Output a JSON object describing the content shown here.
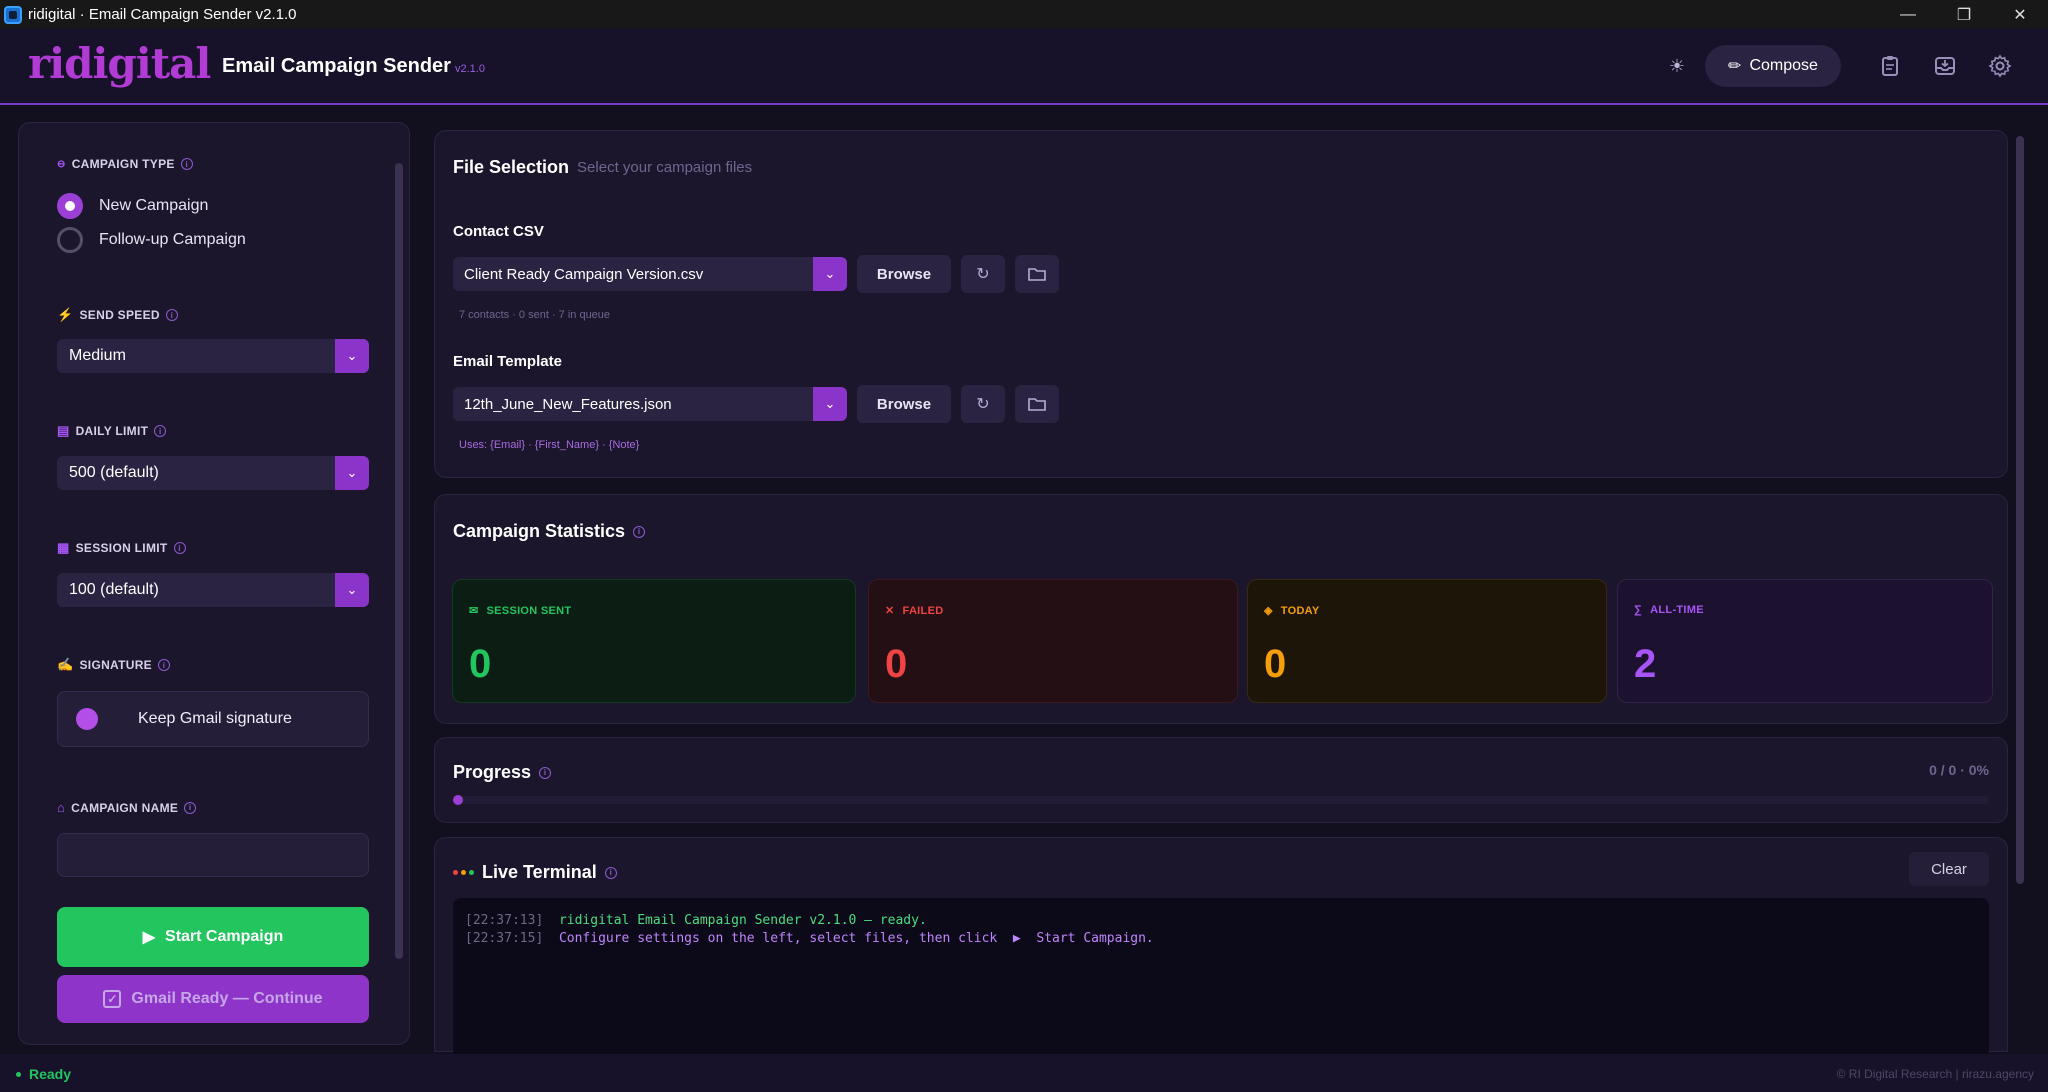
{
  "window": {
    "title": "ridigital · Email Campaign Sender  v2.1.0",
    "controls": {
      "minimize": "—",
      "maximize": "❐",
      "close": "✕"
    }
  },
  "header": {
    "brand": "ridigital",
    "title": "Email Campaign Sender",
    "version": "v2.1.0",
    "compose_label": "Compose",
    "icons": [
      "sun-icon",
      "clipboard-icon",
      "inbox-icon",
      "gear-icon"
    ]
  },
  "sidebar": {
    "campaign_type": {
      "label": "CAMPAIGN TYPE",
      "options": [
        "New Campaign",
        "Follow-up Campaign"
      ],
      "selected": "New Campaign"
    },
    "send_speed": {
      "label": "SEND SPEED",
      "value": "Medium"
    },
    "daily_limit": {
      "label": "DAILY LIMIT",
      "value": "500  (default)"
    },
    "session_limit": {
      "label": "SESSION LIMIT",
      "value": "100  (default)"
    },
    "signature": {
      "label": "SIGNATURE",
      "option": "Keep Gmail signature"
    },
    "campaign_name": {
      "label": "CAMPAIGN NAME",
      "value": ""
    },
    "start_label": "Start Campaign",
    "gmail_label": "Gmail Ready — Continue"
  },
  "files": {
    "title": "File Selection",
    "subtitle": "Select your campaign files",
    "csv": {
      "label": "Contact CSV",
      "value": "Client Ready Campaign Version.csv",
      "meta": "7 contacts  ·  0 sent  ·  7 in queue"
    },
    "template": {
      "label": "Email Template",
      "value": "12th_June_New_Features.json",
      "meta": "Uses:  {Email}  ·  {First_Name}  ·  {Note}"
    },
    "browse_label": "Browse"
  },
  "stats": {
    "title": "Campaign Statistics",
    "cards": [
      {
        "label": "SESSION SENT",
        "value": "0",
        "icon": "envelope-icon",
        "color": "#22c55e"
      },
      {
        "label": "FAILED",
        "value": "0",
        "icon": "x-icon",
        "color": "#ef4444"
      },
      {
        "label": "TODAY",
        "value": "0",
        "icon": "diamond-icon",
        "color": "#f59e0b"
      },
      {
        "label": "ALL-TIME",
        "value": "2",
        "icon": "sigma-icon",
        "color": "#a855f7"
      }
    ]
  },
  "progress": {
    "title": "Progress",
    "meta": "0 / 0  ·  0%",
    "percent": 0
  },
  "terminal": {
    "title": "Live Terminal",
    "clear_label": "Clear",
    "lines": [
      {
        "time": "[22:37:13]",
        "text": "ridigital Email Campaign Sender v2.1.0 — ready.",
        "color": "#4ade80"
      },
      {
        "time": "[22:37:15]",
        "text": "Configure settings on the left, select files, then click  ▶  Start Campaign.",
        "color": "#c084fc"
      }
    ]
  },
  "status": {
    "ready": "Ready",
    "right": "© RI Digital Research  |  rirazu.agency"
  }
}
